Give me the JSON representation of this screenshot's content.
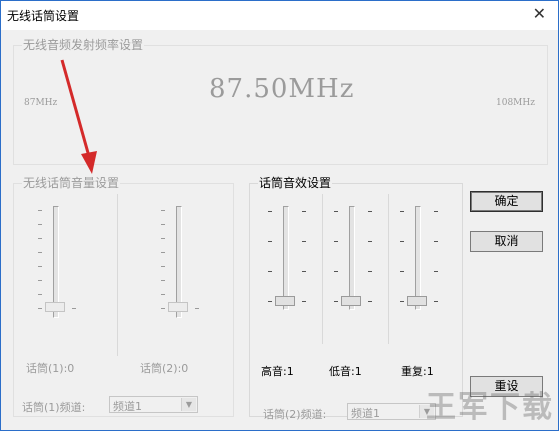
{
  "window": {
    "title": "无线话筒设置",
    "close_glyph": "✕"
  },
  "freq_group": {
    "label": "无线音频发射频率设置",
    "value": "87.50MHz",
    "min_label": "87MHz",
    "max_label": "108MHz"
  },
  "volume_group": {
    "label": "无线话筒音量设置",
    "mic1_label": "话筒(1):0",
    "mic2_label": "话筒(2):0",
    "mic1_level": 0,
    "mic2_level": 0,
    "channel_label": "话筒(1)频道:",
    "channel_value": "频道1"
  },
  "effects_group": {
    "label": "话筒音效设置",
    "treble_label": "高音:1",
    "bass_label": "低音:1",
    "repeat_label": "重复:1",
    "channel_label": "话筒(2)频道:",
    "channel_value": "频道1"
  },
  "buttons": {
    "ok": "确定",
    "cancel": "取消",
    "reset": "重设"
  },
  "watermark": "王军下载"
}
